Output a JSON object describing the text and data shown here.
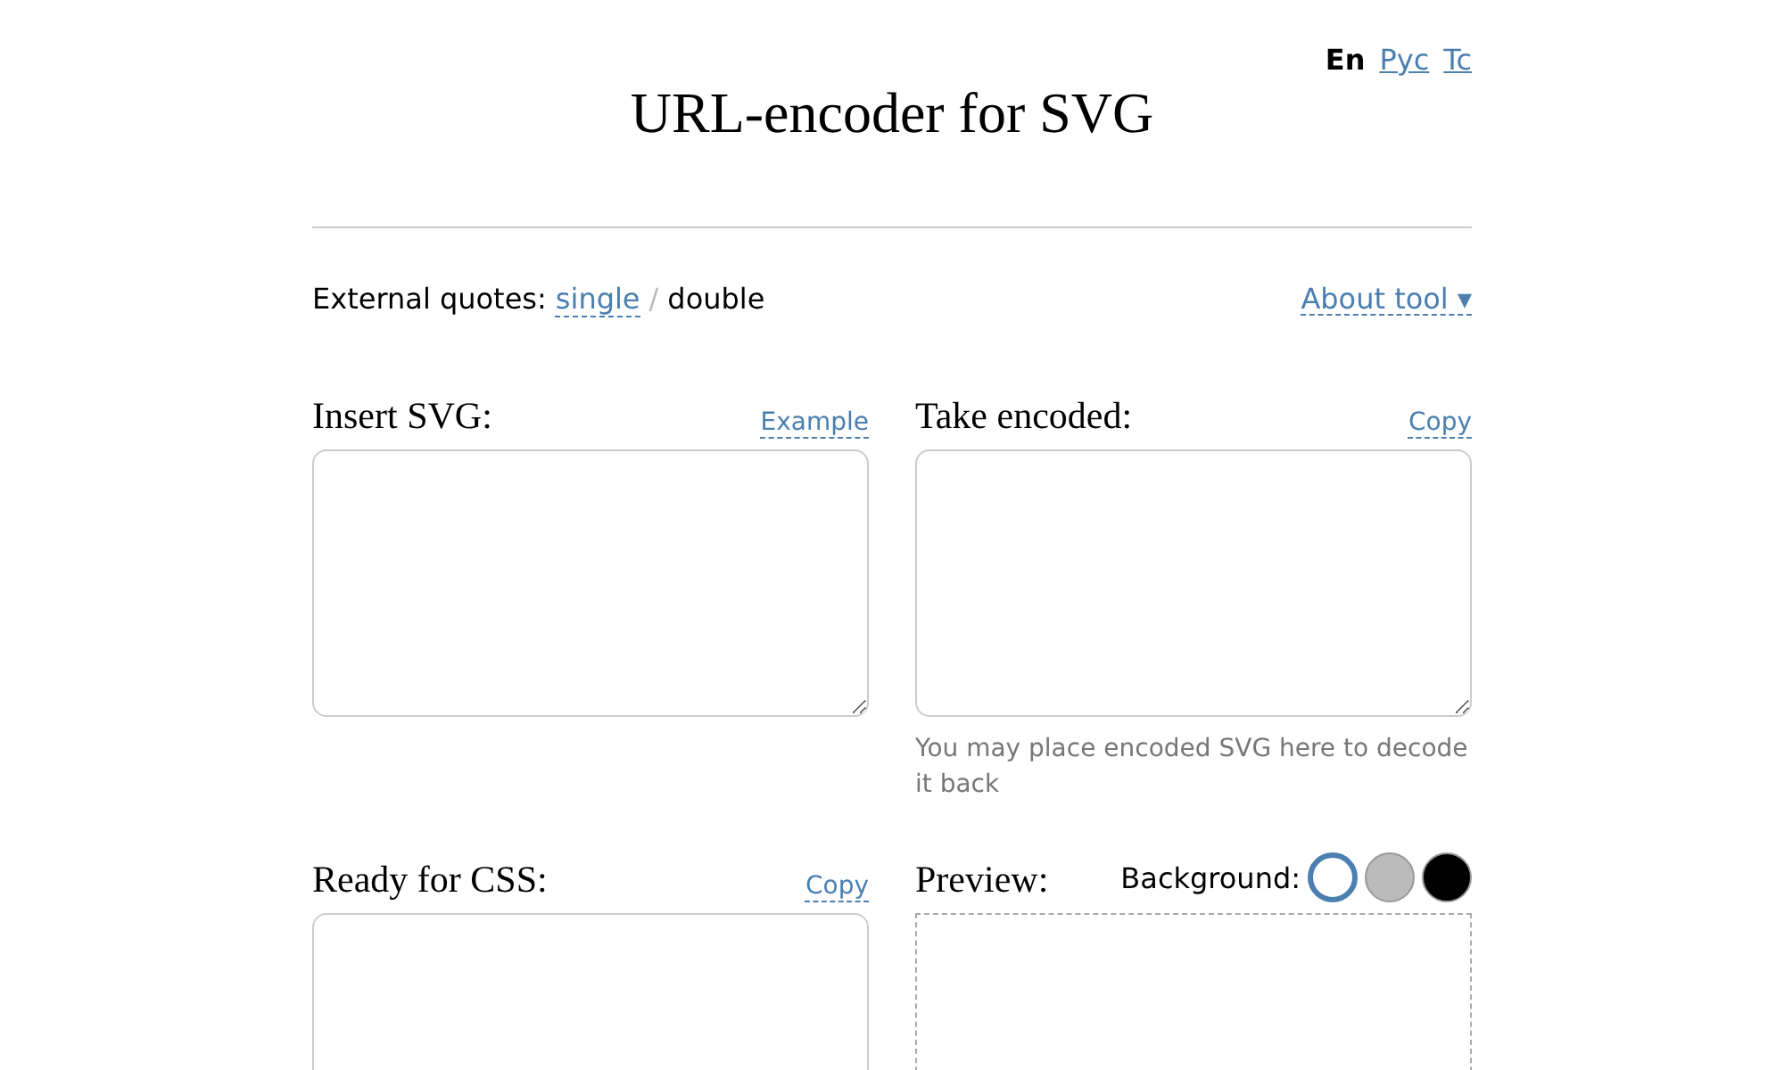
{
  "languages": [
    {
      "label": "En",
      "selected": true
    },
    {
      "label": "Рус",
      "selected": false
    },
    {
      "label": "Tc",
      "selected": false
    }
  ],
  "title": "URL-encoder for SVG",
  "quotes": {
    "label": "External quotes:",
    "separator": "/",
    "options": [
      {
        "label": "single",
        "selected": false
      },
      {
        "label": "double",
        "selected": true
      }
    ]
  },
  "about_link": "About tool ▾",
  "panels": [
    {
      "kind": "textarea",
      "label": "Insert SVG:",
      "action": "Example"
    },
    {
      "kind": "textarea",
      "label": "Take encoded:",
      "action": "Copy",
      "hint": "You may place encoded SVG here to decode it back"
    },
    {
      "kind": "textarea",
      "label": "Ready for CSS:",
      "action": "Copy"
    },
    {
      "kind": "preview",
      "label": "Preview:",
      "background_label": "Background:",
      "swatches": [
        {
          "color": "#ffffff",
          "selected": true
        },
        {
          "color": "#bbbbbb",
          "selected": false
        },
        {
          "color": "#000000",
          "selected": false
        }
      ]
    }
  ]
}
